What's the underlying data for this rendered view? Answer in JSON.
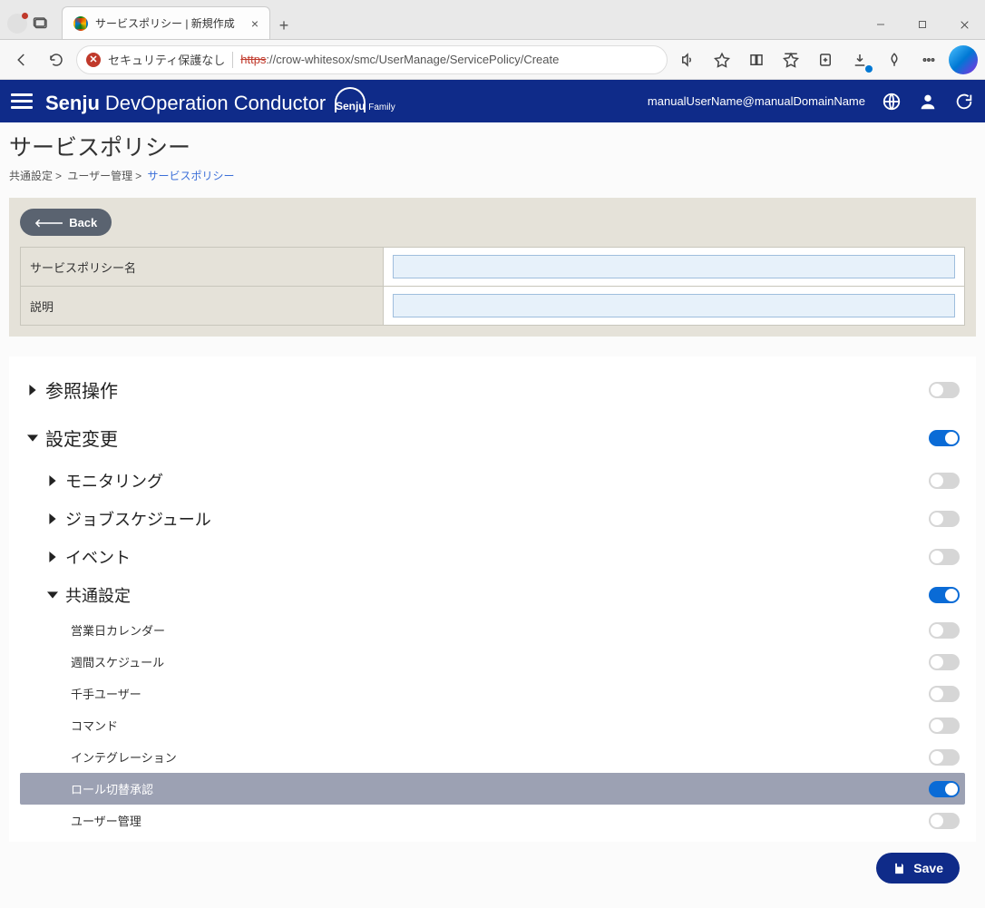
{
  "browser": {
    "tab_title": "サービスポリシー | 新規作成",
    "security_label": "セキュリティ保護なし",
    "url_scheme": "https",
    "url_rest": "://crow-whitesox/smc/UserManage/ServicePolicy/Create"
  },
  "header": {
    "brand1": "Senju",
    "brand2": "DevOperation Conductor",
    "brand_small": "Senju",
    "brand_family": "Family",
    "user": "manualUserName@manualDomainName"
  },
  "page": {
    "title": "サービスポリシー",
    "crumb1": "共通設定",
    "crumb2": "ユーザー管理",
    "crumb3": "サービスポリシー",
    "back": "Back",
    "field_name": "サービスポリシー名",
    "field_desc": "説明",
    "value_name": "",
    "value_desc": ""
  },
  "tree": {
    "n_ref": "参照操作",
    "n_cfg": "設定変更",
    "n_mon": "モニタリング",
    "n_job": "ジョブスケジュール",
    "n_evt": "イベント",
    "n_common": "共通設定",
    "n_cal": "営業日カレンダー",
    "n_wk": "週間スケジュール",
    "n_su": "千手ユーザー",
    "n_cmd": "コマンド",
    "n_int": "インテグレーション",
    "n_role": "ロール切替承認",
    "n_um": "ユーザー管理"
  },
  "toggles": {
    "ref": false,
    "cfg": true,
    "mon": false,
    "job": false,
    "evt": false,
    "common": true,
    "cal": false,
    "wk": false,
    "su": false,
    "cmd": false,
    "int": false,
    "role": true,
    "um": false
  },
  "save": "Save"
}
